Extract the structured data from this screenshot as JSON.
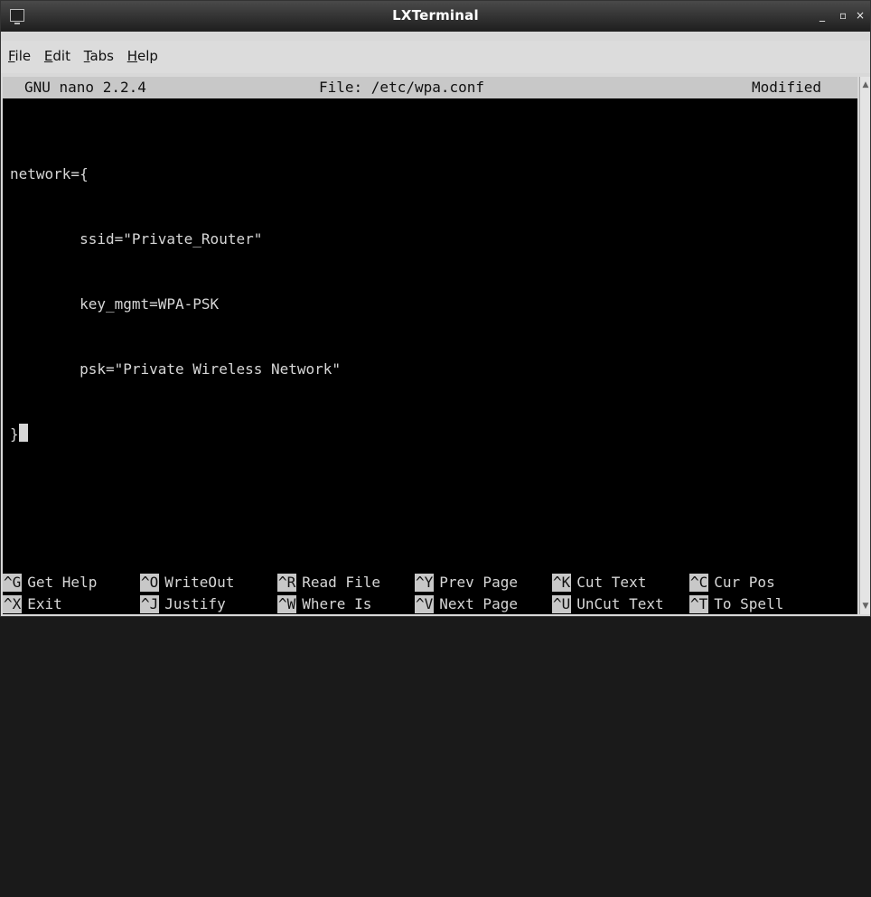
{
  "window": {
    "title": "LXTerminal",
    "controls": {
      "minimize": "_",
      "maximize": "▫",
      "close": "×"
    }
  },
  "menubar": {
    "items": [
      {
        "accel": "F",
        "rest": "ile"
      },
      {
        "accel": "E",
        "rest": "dit"
      },
      {
        "accel": "T",
        "rest": "abs"
      },
      {
        "accel": "H",
        "rest": "elp"
      }
    ]
  },
  "nano": {
    "version": "GNU nano 2.2.4",
    "file": "File: /etc/wpa.conf",
    "state": "Modified"
  },
  "editor": {
    "lines": [
      "network={",
      "        ssid=\"Private_Router\"",
      "        key_mgmt=WPA-PSK",
      "        psk=\"Private Wireless Network\"",
      "}"
    ]
  },
  "shortcuts": {
    "row1": [
      {
        "key": "^G",
        "label": "Get Help"
      },
      {
        "key": "^O",
        "label": "WriteOut"
      },
      {
        "key": "^R",
        "label": "Read File"
      },
      {
        "key": "^Y",
        "label": "Prev Page"
      },
      {
        "key": "^K",
        "label": "Cut Text"
      },
      {
        "key": "^C",
        "label": "Cur Pos"
      }
    ],
    "row2": [
      {
        "key": "^X",
        "label": "Exit"
      },
      {
        "key": "^J",
        "label": "Justify"
      },
      {
        "key": "^W",
        "label": "Where Is"
      },
      {
        "key": "^V",
        "label": "Next Page"
      },
      {
        "key": "^U",
        "label": "UnCut Text"
      },
      {
        "key": "^T",
        "label": "To Spell"
      }
    ]
  },
  "scrollbar": {
    "up_icon": "up-arrow",
    "down_icon": "down-arrow"
  }
}
